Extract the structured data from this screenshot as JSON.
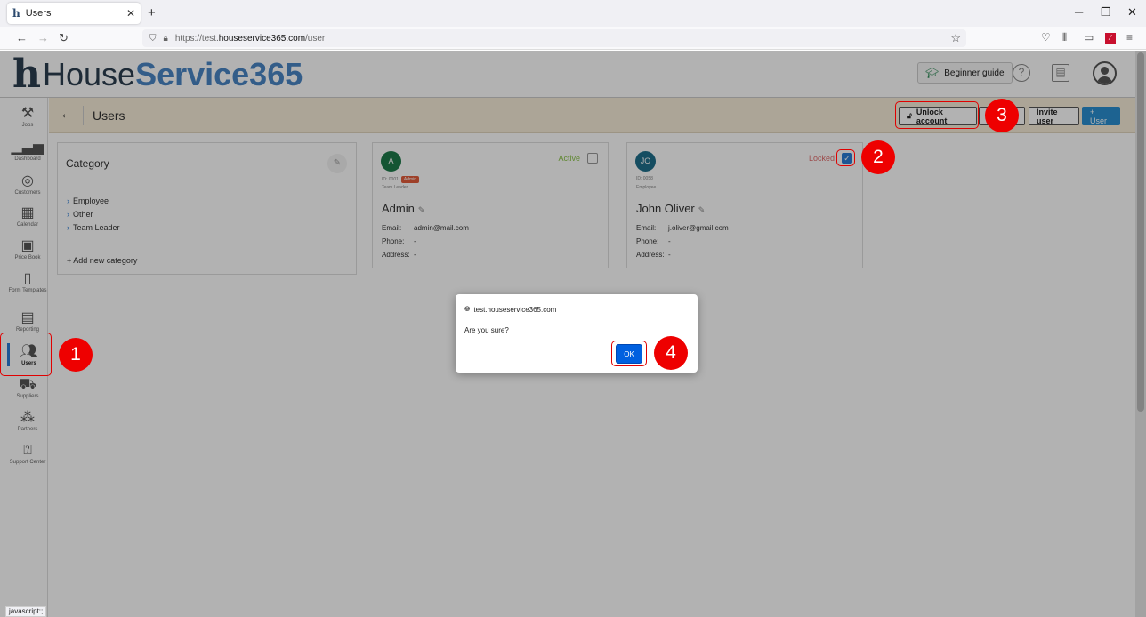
{
  "browser": {
    "tab_title": "Users",
    "tab_favicon": "h",
    "url_prefix": "https://test.",
    "url_domain": "houseservice365.com",
    "url_path": "/user",
    "status_url": "javascript:;"
  },
  "header": {
    "logo_mark": "h",
    "logo_part1": "House",
    "logo_part2": "Service365",
    "beginner_guide": "Beginner guide",
    "help_glyph": "?"
  },
  "sidebar": {
    "items": [
      {
        "label": "Jobs",
        "icon": "tools-icon"
      },
      {
        "label": "Dashboard",
        "icon": "chart-icon"
      },
      {
        "label": "Customers",
        "icon": "customers-icon"
      },
      {
        "label": "Calendar",
        "icon": "calendar-icon"
      },
      {
        "label": "Price Book",
        "icon": "price-book-icon"
      },
      {
        "label": "Form Templates",
        "icon": "form-icon"
      },
      {
        "label": "Reporting",
        "icon": "report-icon"
      },
      {
        "label": "Users",
        "icon": "users-icon"
      },
      {
        "label": "Suppliers",
        "icon": "truck-icon"
      },
      {
        "label": "Partners",
        "icon": "partners-icon"
      },
      {
        "label": "Support Center",
        "icon": "help-icon"
      }
    ]
  },
  "toolbar": {
    "title": "Users",
    "unlock": "Unlock account",
    "invite": "Invite user",
    "add_user": "+ User"
  },
  "category": {
    "title": "Category",
    "items": [
      "Employee",
      "Other",
      "Team Leader"
    ],
    "add": "Add new category"
  },
  "users": [
    {
      "initials": "A",
      "id": "ID: 0001",
      "badge": "Admin",
      "role": "Team Leader",
      "name": "Admin",
      "status": "Active",
      "email_label": "Email:",
      "email": "admin@mail.com",
      "phone_label": "Phone:",
      "phone": "-",
      "address_label": "Address:",
      "address": "-",
      "avatar_color": "#1e7a4a",
      "status_color": "#8bc34a"
    },
    {
      "initials": "JO",
      "id": "ID: 0058",
      "badge": "",
      "role": "Employee",
      "name": "John Oliver",
      "status": "Locked",
      "email_label": "Email:",
      "email": "j.oliver@gmail.com",
      "phone_label": "Phone:",
      "phone": "-",
      "address_label": "Address:",
      "address": "-",
      "avatar_color": "#1f6f8b",
      "status_color": "#e06c6c"
    }
  ],
  "dialog": {
    "origin": "test.houseservice365.com",
    "message": "Are you sure?",
    "ok": "OK"
  },
  "annotations": [
    "1",
    "2",
    "3",
    "4"
  ]
}
